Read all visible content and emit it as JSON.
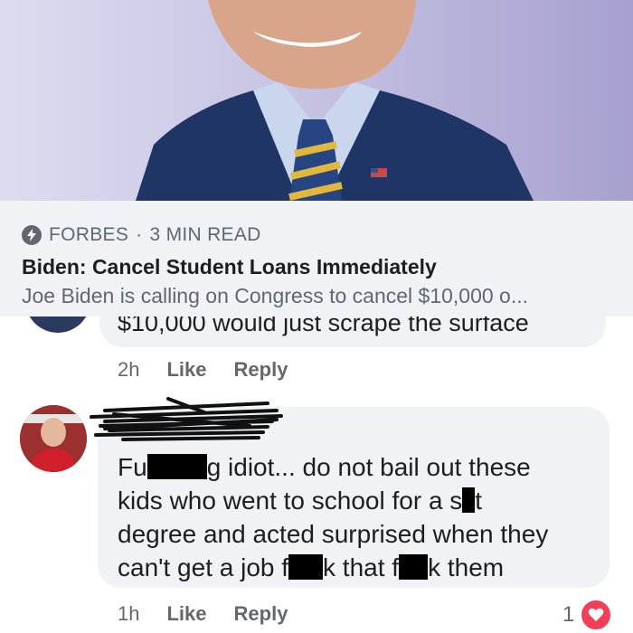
{
  "link_preview": {
    "source": "FORBES",
    "separator": "·",
    "read_time": "3 MIN READ",
    "headline": "Biden: Cancel Student Loans Immediately",
    "snippet": "Joe Biden is calling on Congress to cancel $10,000 o..."
  },
  "comment1": {
    "text": "$10,000 would just scrape the surface",
    "time": "2h",
    "like": "Like",
    "reply": "Reply"
  },
  "comment2": {
    "line1_a": "Fu",
    "line1_b": "g idiot... do not bail out these",
    "line2_a": "kids who went to school for a s",
    "line2_b": "t",
    "line3": "degree and acted surprised when they",
    "line4_a": "can't get a job f",
    "line4_b": "k that f",
    "line4_c": "k them",
    "time": "1h",
    "like": "Like",
    "reply": "Reply",
    "reaction_count": "1",
    "reaction_icon": "heart-reaction-icon"
  },
  "colors": {
    "bubble_bg": "#f0f2f5",
    "meta_gray": "#65676b",
    "heart_red": "#f33e58"
  }
}
